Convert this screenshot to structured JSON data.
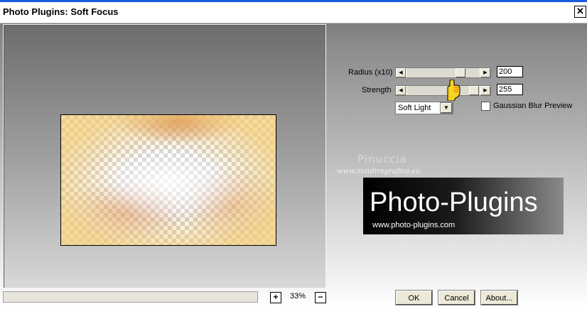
{
  "window": {
    "title": "Photo Plugins: Soft Focus",
    "close_glyph": "✕"
  },
  "controls": {
    "radius": {
      "label": "Radius (x10)",
      "value": "200",
      "level": 0.78
    },
    "strength": {
      "label": "Strength",
      "value": "255",
      "level": 1.0
    },
    "blend_mode": {
      "selected": "Soft Light"
    },
    "gaussian_blur_preview": {
      "label": "Gaussian Blur Preview",
      "checked": false
    }
  },
  "zoom": {
    "plus": "+",
    "value": "33%",
    "minus": "−"
  },
  "watermark": {
    "name": "Pinuccia",
    "site": "www.maidiregrafica.eu"
  },
  "logo": {
    "title": "Photo-Plugins",
    "url": "www.photo-plugins.com"
  },
  "buttons": {
    "ok": "OK",
    "cancel": "Cancel",
    "about": "About..."
  },
  "icons": {
    "left_arrow": "◀",
    "right_arrow": "▶",
    "dropdown": "▼",
    "cursor": "pointing-hand-icon"
  },
  "colors": {
    "titlebar_accent": "#1c5ae0",
    "button_face": "#ece9d8"
  }
}
